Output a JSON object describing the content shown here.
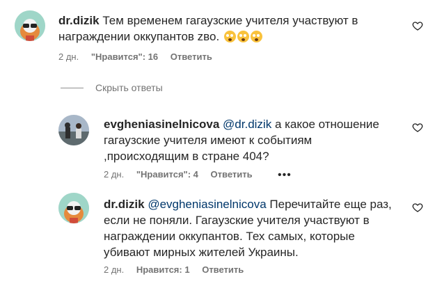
{
  "comments": [
    {
      "username": "dr.dizik",
      "text": "Тем временем гагаузские учителя участвуют в награждении оккупантов zво.",
      "emoji": [
        "astonished-face",
        "astonished-face",
        "astonished-face"
      ],
      "time": "2 дн.",
      "likes": "\"Нравится\": 16",
      "reply": "Ответить"
    }
  ],
  "replies_toggle": "Скрыть ответы",
  "replies": [
    {
      "username": "evgheniasinelnicova",
      "mention": "@dr.dizik",
      "text": "а какое отношение гагаузские учителя имеют к событиям ,происходящим в стране 404?",
      "time": "2 дн.",
      "likes": "\"Нравится\": 4",
      "reply": "Ответить",
      "more": "•••"
    },
    {
      "username": "dr.dizik",
      "mention": "@evgheniasinelnicova",
      "text": "Перечитайте еще раз, если не поняли. Гагаузские учителя участвуют в награждении оккупантов. Тех самых, которые убивают мирных жителей Украины.",
      "time": "2 дн.",
      "likes": "Нравится: 1",
      "reply": "Ответить"
    }
  ],
  "colors": {
    "text": "#262626",
    "meta": "#737373",
    "mention": "#00376b"
  }
}
